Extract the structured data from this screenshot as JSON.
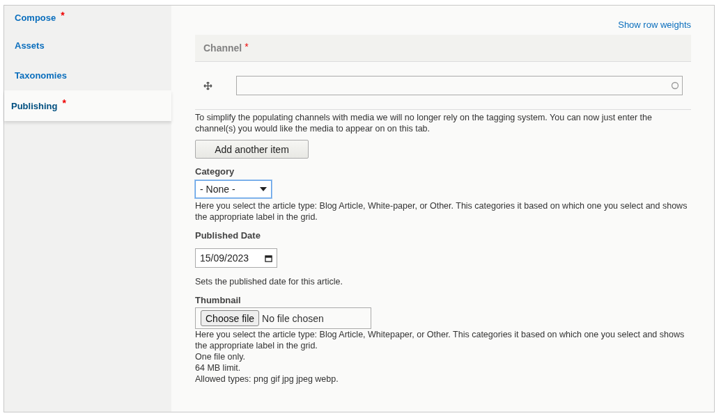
{
  "sidebar": {
    "items": [
      {
        "label": "Compose",
        "required_mark": "*",
        "selected": false
      },
      {
        "label": "Assets",
        "selected": false
      },
      {
        "label": "Taxonomies",
        "selected": false
      },
      {
        "label": "Publishing",
        "required_mark": "*",
        "selected": true
      }
    ]
  },
  "show_row_weights": "Show row weights",
  "channel": {
    "label": "Channel",
    "required_mark": "*",
    "description": "To simplify the populating channels with media we will no longer rely on the tagging system. You can now just enter the channel(s) you would like the media to appear on on this tab.",
    "add_button": "Add another item"
  },
  "category": {
    "label": "Category",
    "value": "- None -",
    "focused": true,
    "description": "Here you select the article type: Blog Article, White-paper, or Other. This categories it based on which one you select and shows the appropriate label in the grid."
  },
  "published_date": {
    "label": "Published Date",
    "value": "15/09/2023",
    "description": "Sets the published date for this article."
  },
  "thumbnail": {
    "label": "Thumbnail",
    "button": "Choose file",
    "status": "No file chosen",
    "descriptions": [
      "Here you select the article type: Blog Article, Whitepaper, or Other. This categories it based on which one you select and shows the appropriate label in the grid.",
      "One file only.",
      "64 MB limit.",
      "Allowed types: png gif jpg jpeg webp."
    ]
  }
}
